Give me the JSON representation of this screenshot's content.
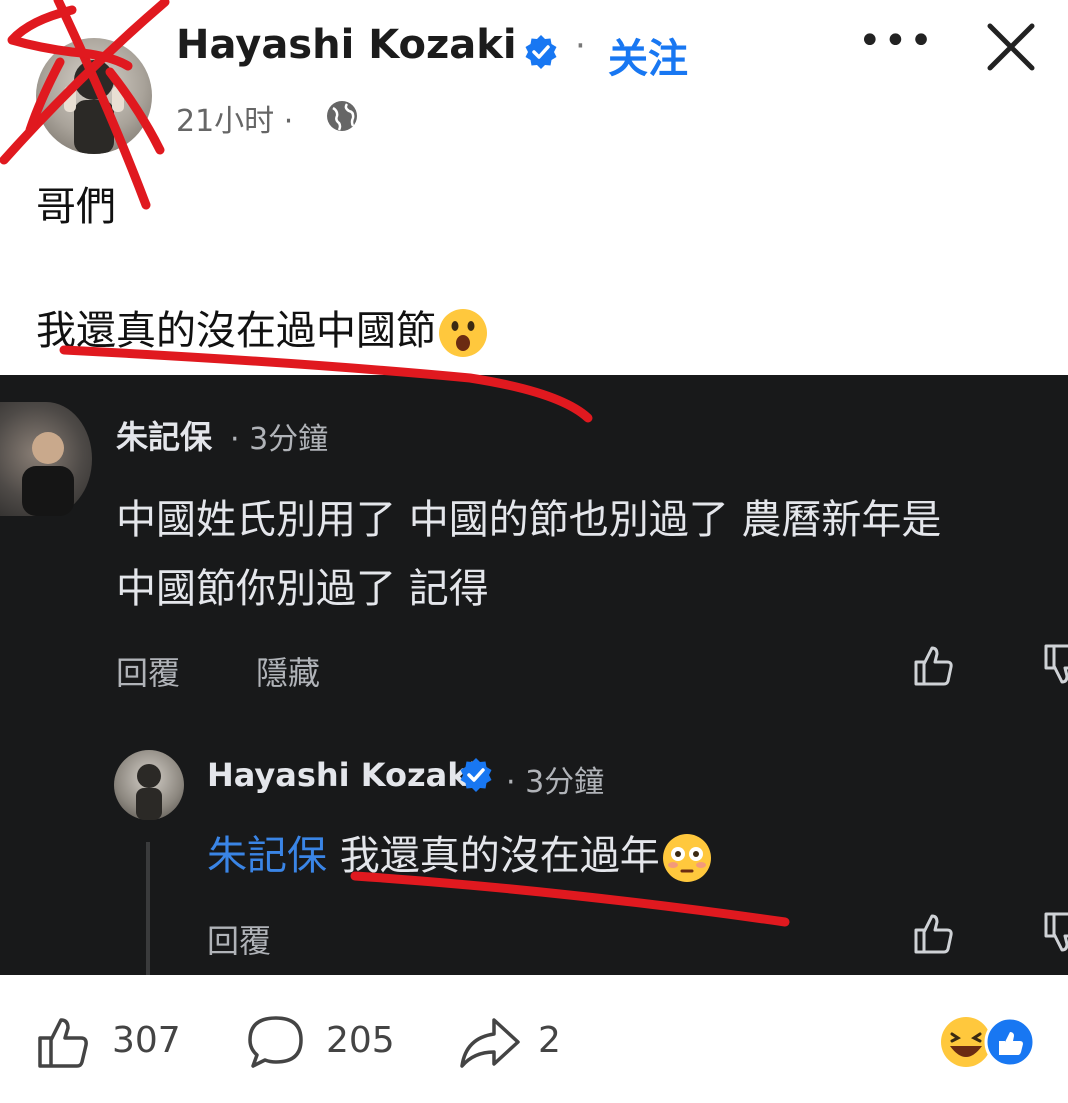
{
  "post": {
    "author": "Hayashi Kozaki",
    "separator": "·",
    "follow_label": "关注",
    "time": "21小时 ·",
    "line1": "哥們",
    "line2": "我還真的沒在過中國節",
    "more_label": "•••"
  },
  "comments": [
    {
      "author": "朱記保",
      "time": "· 3分鐘",
      "line1": "中國姓氏別用了  中國的節也別過了  農曆新年是",
      "line2": "中國節你別過了 記得",
      "reply_label": "回覆",
      "hide_label": "隱藏"
    }
  ],
  "reply": {
    "author": "Hayashi Kozaki",
    "time": "· 3分鐘",
    "mention": "朱記保",
    "text": " 我還真的沒在過年",
    "reply_label": "回覆"
  },
  "footer": {
    "likes": "307",
    "comments": "205",
    "shares": "2"
  },
  "colors": {
    "accent": "#1877f2",
    "panel_bg": "#18191a",
    "annotation": "#e0191f"
  },
  "icons": [
    "verified-badge-icon",
    "globe-icon",
    "close-icon",
    "thumbs-up-icon",
    "thumbs-down-icon",
    "comment-icon",
    "share-icon",
    "surprised-emoji",
    "flushed-emoji",
    "haha-reaction",
    "like-reaction"
  ]
}
